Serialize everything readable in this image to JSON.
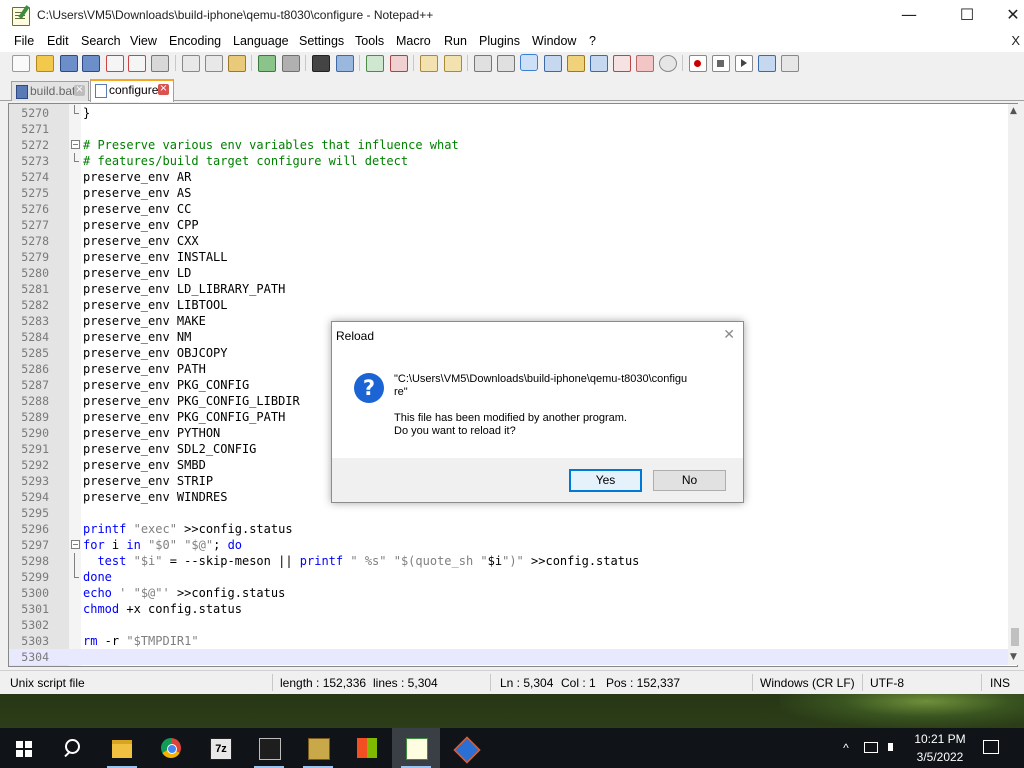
{
  "window": {
    "title": "C:\\Users\\VM5\\Downloads\\build-iphone\\qemu-t8030\\configure - Notepad++",
    "minimize_glyph": "—",
    "maximize_glyph": "☐",
    "close_glyph": "✕"
  },
  "menu": [
    "File",
    "Edit",
    "Search",
    "View",
    "Encoding",
    "Language",
    "Settings",
    "Tools",
    "Macro",
    "Run",
    "Plugins",
    "Window",
    "?"
  ],
  "menu_close": "X",
  "tabs": [
    {
      "label": "build.bat",
      "active": false
    },
    {
      "label": "configure",
      "active": true
    }
  ],
  "editor": {
    "lines": [
      {
        "n": "5270",
        "fold": "end",
        "text": "}"
      },
      {
        "n": "5271",
        "fold": "",
        "text": ""
      },
      {
        "n": "5272",
        "fold": "box",
        "text": "# Preserve various env variables that influence what"
      },
      {
        "n": "5273",
        "fold": "end",
        "text": "# features/build target configure will detect"
      },
      {
        "n": "5274",
        "fold": "",
        "text": "preserve_env AR"
      },
      {
        "n": "5275",
        "fold": "",
        "text": "preserve_env AS"
      },
      {
        "n": "5276",
        "fold": "",
        "text": "preserve_env CC"
      },
      {
        "n": "5277",
        "fold": "",
        "text": "preserve_env CPP"
      },
      {
        "n": "5278",
        "fold": "",
        "text": "preserve_env CXX"
      },
      {
        "n": "5279",
        "fold": "",
        "text": "preserve_env INSTALL"
      },
      {
        "n": "5280",
        "fold": "",
        "text": "preserve_env LD"
      },
      {
        "n": "5281",
        "fold": "",
        "text": "preserve_env LD_LIBRARY_PATH"
      },
      {
        "n": "5282",
        "fold": "",
        "text": "preserve_env LIBTOOL"
      },
      {
        "n": "5283",
        "fold": "",
        "text": "preserve_env MAKE"
      },
      {
        "n": "5284",
        "fold": "",
        "text": "preserve_env NM"
      },
      {
        "n": "5285",
        "fold": "",
        "text": "preserve_env OBJCOPY"
      },
      {
        "n": "5286",
        "fold": "",
        "text": "preserve_env PATH"
      },
      {
        "n": "5287",
        "fold": "",
        "text": "preserve_env PKG_CONFIG"
      },
      {
        "n": "5288",
        "fold": "",
        "text": "preserve_env PKG_CONFIG_LIBDIR"
      },
      {
        "n": "5289",
        "fold": "",
        "text": "preserve_env PKG_CONFIG_PATH"
      },
      {
        "n": "5290",
        "fold": "",
        "text": "preserve_env PYTHON"
      },
      {
        "n": "5291",
        "fold": "",
        "text": "preserve_env SDL2_CONFIG"
      },
      {
        "n": "5292",
        "fold": "",
        "text": "preserve_env SMBD"
      },
      {
        "n": "5293",
        "fold": "",
        "text": "preserve_env STRIP"
      },
      {
        "n": "5294",
        "fold": "",
        "text": "preserve_env WINDRES"
      },
      {
        "n": "5295",
        "fold": "",
        "text": ""
      },
      {
        "n": "5296",
        "fold": "",
        "text": "printf \"exec\" >>config.status"
      },
      {
        "n": "5297",
        "fold": "box",
        "text": "for i in \"$0\" \"$@\"; do"
      },
      {
        "n": "5298",
        "fold": "mid",
        "text": "  test \"$i\" = --skip-meson || printf \" %s\" \"$(quote_sh \"$i\")\" >>config.status"
      },
      {
        "n": "5299",
        "fold": "end",
        "text": "done"
      },
      {
        "n": "5300",
        "fold": "",
        "text": "echo ' \"$@\"' >>config.status"
      },
      {
        "n": "5301",
        "fold": "",
        "text": "chmod +x config.status"
      },
      {
        "n": "5302",
        "fold": "",
        "text": ""
      },
      {
        "n": "5303",
        "fold": "",
        "text": "rm -r \"$TMPDIR1\""
      },
      {
        "n": "5304",
        "fold": "",
        "text": "",
        "current": true
      }
    ]
  },
  "status": {
    "filetype": "Unix script file",
    "length": "length : 152,336",
    "lines": "lines : 5,304",
    "ln": "Ln : 5,304",
    "col": "Col : 1",
    "pos": "Pos : 152,337",
    "eol": "Windows (CR LF)",
    "encoding": "UTF-8",
    "mode": "INS"
  },
  "dialog": {
    "title": "Reload",
    "close_glyph": "✕",
    "icon_glyph": "?",
    "path_line1": "\"C:\\Users\\VM5\\Downloads\\build-iphone\\qemu-t8030\\configu",
    "path_line2": "re\"",
    "message1": "This file has been modified by another program.",
    "message2": "Do you want to reload it?",
    "yes_label": "Yes",
    "no_label": "No"
  },
  "taskbar": {
    "time": "10:21 PM",
    "date": "3/5/2022",
    "tray_up_glyph": "^"
  },
  "colors": {
    "comment": "#008000",
    "keyword": "#0000ff",
    "string": "#808080",
    "tab_accent": "#f5a623",
    "dialog_icon": "#1c64d4",
    "taskbar": "#101418"
  }
}
